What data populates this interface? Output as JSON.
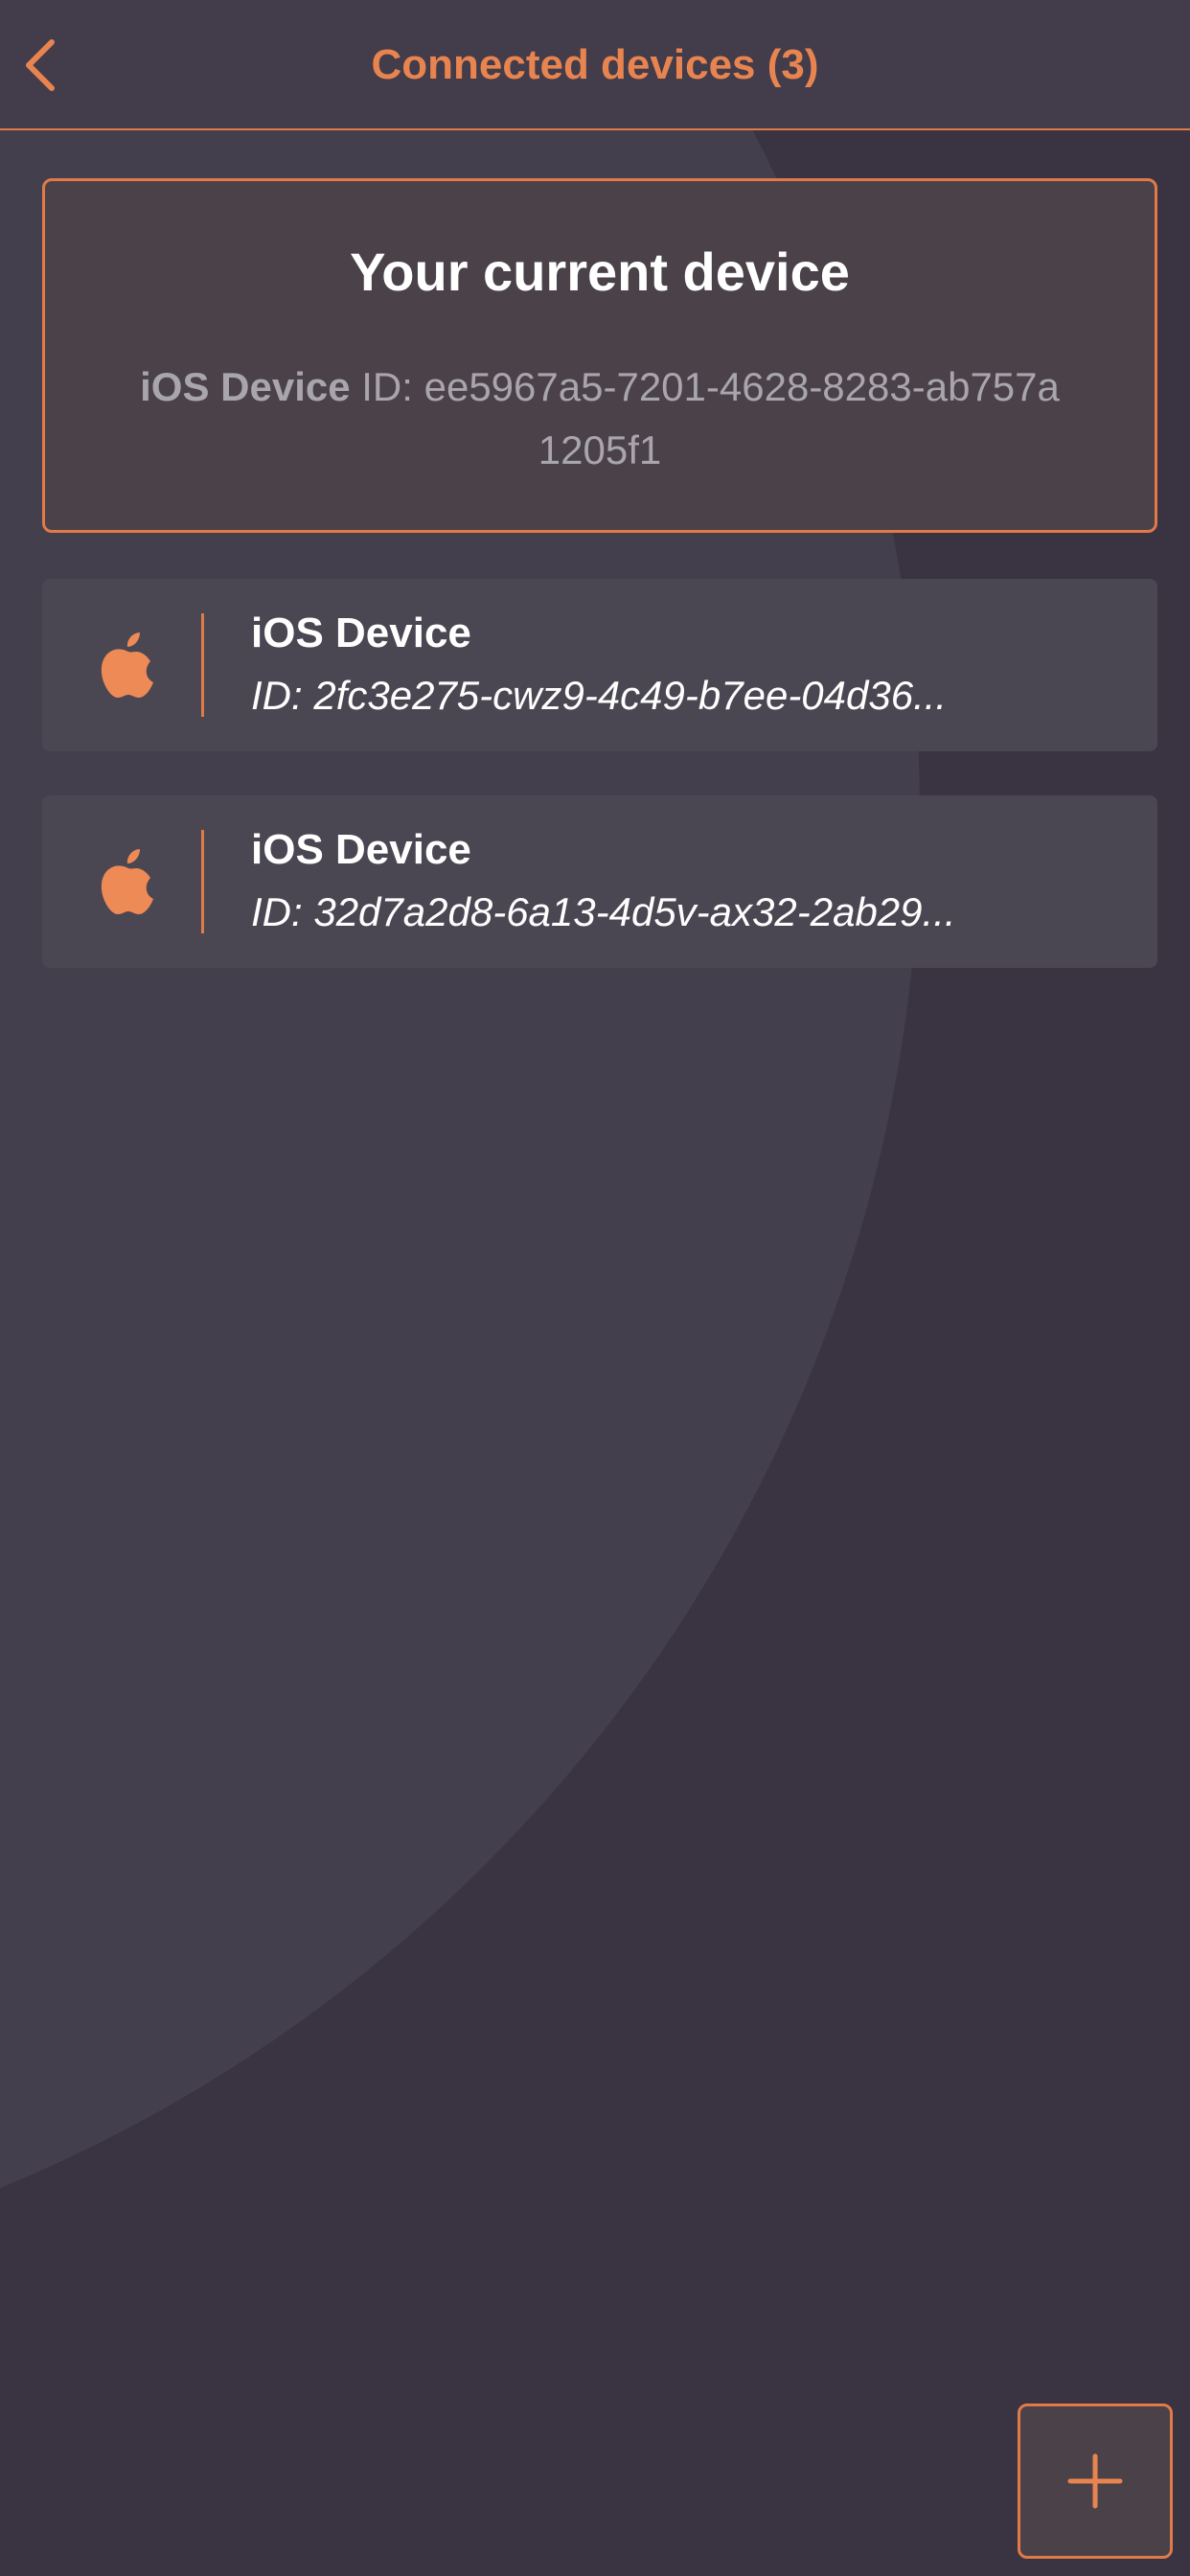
{
  "header": {
    "title": "Connected devices (3)",
    "back_icon": "chevron-left-icon"
  },
  "current_device": {
    "title": "Your current device",
    "device_name": "iOS Device",
    "id_prefix": " ID: ",
    "id": "ee5967a5-7201-4628-8283-ab757a1205f1"
  },
  "devices": [
    {
      "icon": "apple-icon",
      "name": "iOS Device",
      "id_text": "ID: 2fc3e275-cwz9-4c49-b7ee-04d36..."
    },
    {
      "icon": "apple-icon",
      "name": "iOS Device",
      "id_text": "ID: 32d7a2d8-6a13-4d5v-ax32-2ab29..."
    }
  ],
  "add_button": {
    "icon": "plus-icon"
  },
  "colors": {
    "accent": "#e8844f",
    "background": "#3a3342",
    "card": "#4a4752"
  }
}
